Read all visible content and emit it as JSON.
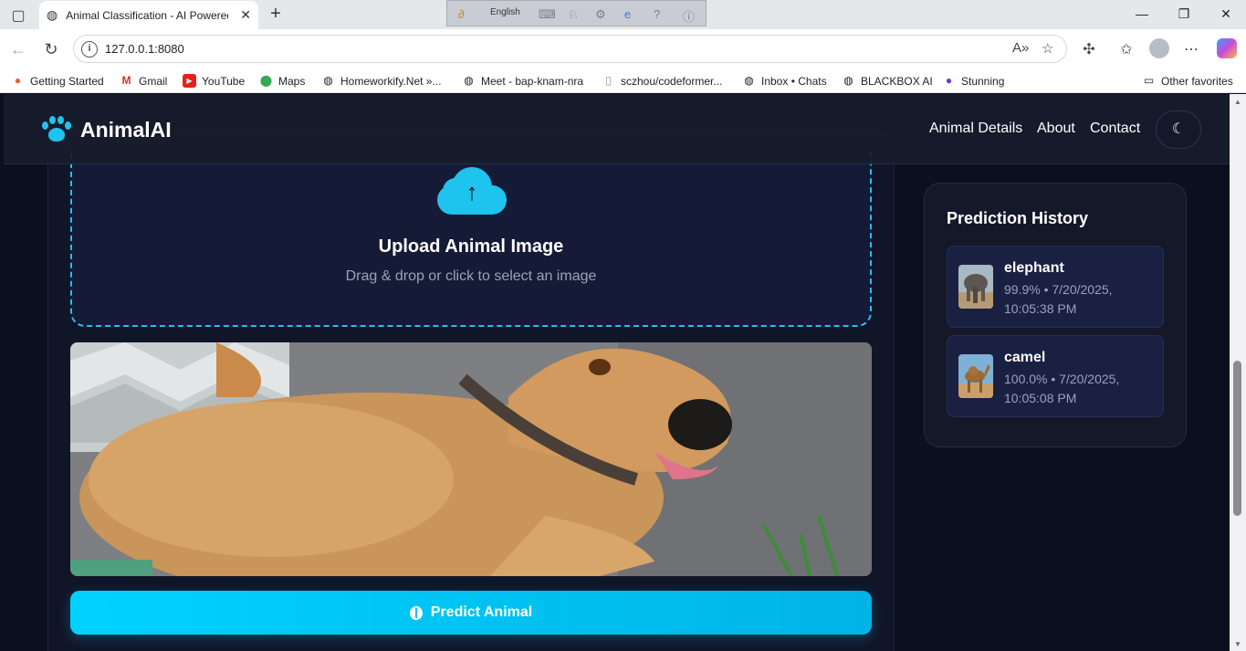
{
  "browser": {
    "tab_title": "Animal Classification - AI Powered Animal Classification",
    "url": "127.0.0.1:8080",
    "ime_language": "English",
    "bookmarks": [
      {
        "label": "Getting Started"
      },
      {
        "label": "Gmail"
      },
      {
        "label": "YouTube"
      },
      {
        "label": "Maps"
      },
      {
        "label": "Homeworkify.Net »..."
      },
      {
        "label": "Meet - bap-knam-nra"
      },
      {
        "label": "sczhou/codeformer..."
      },
      {
        "label": "Inbox • Chats"
      },
      {
        "label": "BLACKBOX AI"
      },
      {
        "label": "Stunning"
      }
    ],
    "other_favorites": "Other favorites"
  },
  "header": {
    "brand": "AnimalAI",
    "nav": [
      "Animal Details",
      "About",
      "Contact"
    ],
    "theme_icon": "moon-icon"
  },
  "upload": {
    "title": "Upload Animal Image",
    "subtitle": "Drag & drop or click to select an image"
  },
  "predict_button": "Predict Animal",
  "history": {
    "title": "Prediction History",
    "items": [
      {
        "name": "elephant",
        "meta": "99.9% • 7/20/2025, 10:05:38 PM"
      },
      {
        "name": "camel",
        "meta": "100.0% • 7/20/2025, 10:05:08 PM"
      }
    ]
  },
  "colors": {
    "accent": "#1ec3ee",
    "background": "#0c0f1e",
    "card": "#141829"
  }
}
